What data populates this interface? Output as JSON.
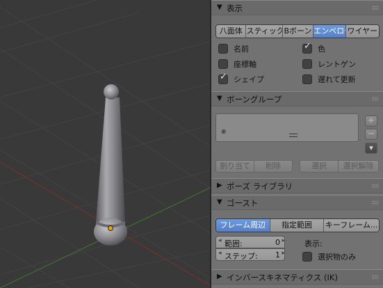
{
  "viewport": {
    "object": "bone-envelope-shape"
  },
  "panels": {
    "display": {
      "title": "表示",
      "modes": [
        "八面体",
        "スティック",
        "Bボーン",
        "エンベロープ",
        "ワイヤー"
      ],
      "active_mode": "エンベロープ",
      "options": {
        "name": {
          "label": "名前",
          "checked": false
        },
        "color": {
          "label": "色",
          "checked": true
        },
        "axes": {
          "label": "座標軸",
          "checked": false
        },
        "xray": {
          "label": "レントゲン",
          "checked": false
        },
        "shape": {
          "label": "シェイプ",
          "checked": true
        },
        "delay_refresh": {
          "label": "遅れて更新",
          "checked": false
        }
      }
    },
    "bone_groups": {
      "title": "ボーングループ",
      "assign": "割り当て",
      "remove": "削除",
      "select": "選択",
      "deselect": "選択解除"
    },
    "pose_library": {
      "title": "ポーズ ライブラリ"
    },
    "ghost": {
      "title": "ゴースト",
      "modes": [
        "フレーム周辺",
        "指定範囲",
        "キーフレーム..."
      ],
      "active_mode": "フレーム周辺",
      "range_label": "範囲:",
      "range_value": "0",
      "step_label": "ステップ:",
      "step_value": "1",
      "display_label": "表示:",
      "selected_only": {
        "label": "選択物のみ",
        "checked": false
      }
    },
    "ik": {
      "title": "インバースキネマティクス (IK)"
    }
  }
}
